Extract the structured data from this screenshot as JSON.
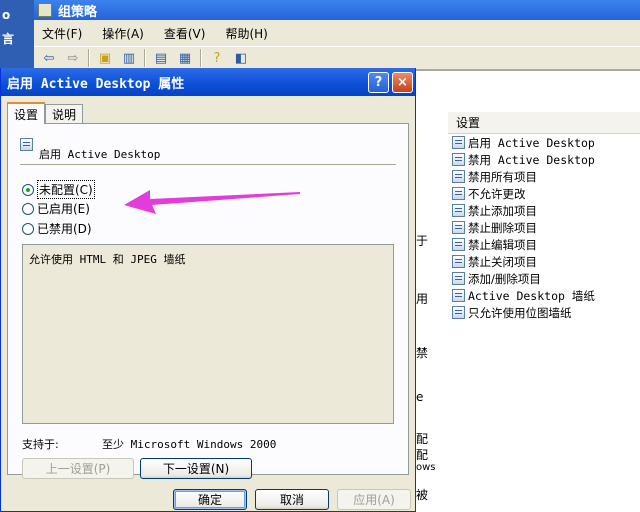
{
  "background_window": {
    "title": "组策略",
    "left_fragments": [
      "o",
      "言"
    ],
    "menu": [
      "文件(F)",
      "操作(A)",
      "查看(V)",
      "帮助(H)"
    ],
    "toolbar_icons": [
      "back-arrow-icon",
      "forward-arrow-icon",
      "up-folder-icon",
      "show-hide-tree-icon",
      "export-icon",
      "properties-icon",
      "help-icon",
      "console-icon"
    ]
  },
  "settings_list": {
    "header": "设置",
    "items": [
      "启用 Active Desktop",
      "禁用 Active Desktop",
      "禁用所有项目",
      "不允许更改",
      "禁止添加项目",
      "禁止删除项目",
      "禁止编辑项目",
      "禁止关闭项目",
      "添加/删除项目",
      "Active Desktop 墙纸",
      "只允许使用位图墙纸"
    ]
  },
  "middle_fragments": [
    "于",
    "用",
    "禁",
    "e",
    "配",
    "配",
    "ows",
    "被"
  ],
  "dialog": {
    "title": "启用 Active Desktop 属性",
    "help_symbol": "?",
    "close_symbol": "×",
    "tabs": [
      "设置",
      "说明"
    ],
    "policy_name": "启用 Active Desktop",
    "radios": [
      {
        "label": "未配置(C)",
        "checked": true
      },
      {
        "label": "已启用(E)",
        "checked": false
      },
      {
        "label": "已禁用(D)",
        "checked": false
      }
    ],
    "description": "允许使用 HTML 和 JPEG 墙纸",
    "supported_label": "支持于:",
    "supported_value": "至少 Microsoft Windows 2000",
    "prev_button": "上一设置(P)",
    "next_button": "下一设置(N)",
    "ok_button": "确定",
    "cancel_button": "取消",
    "apply_button": "应用(A)"
  },
  "annotation_color": "#e33cdb"
}
